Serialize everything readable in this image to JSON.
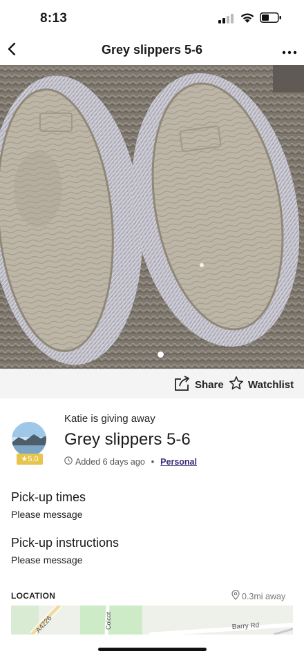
{
  "status_bar": {
    "time": "8:13"
  },
  "nav": {
    "title": "Grey slippers 5-6"
  },
  "actions": {
    "share_label": "Share",
    "watchlist_label": "Watchlist"
  },
  "giver": {
    "text": "Katie is giving away",
    "rating": "★5.0"
  },
  "item": {
    "title": "Grey slippers 5-6",
    "added": "Added 6 days ago",
    "separator": "•",
    "category": "Personal"
  },
  "pickup_times": {
    "title": "Pick-up times",
    "body": "Please message"
  },
  "pickup_instructions": {
    "title": "Pick-up instructions",
    "body": "Please message"
  },
  "location": {
    "label": "LOCATION",
    "distance": "0.3mi away",
    "map_labels": {
      "road1": "A4226",
      "road2": "Colcot",
      "road3": "Barry Rd"
    }
  },
  "photo": {
    "icon": "slippers-photo",
    "carousel_count": 1
  }
}
